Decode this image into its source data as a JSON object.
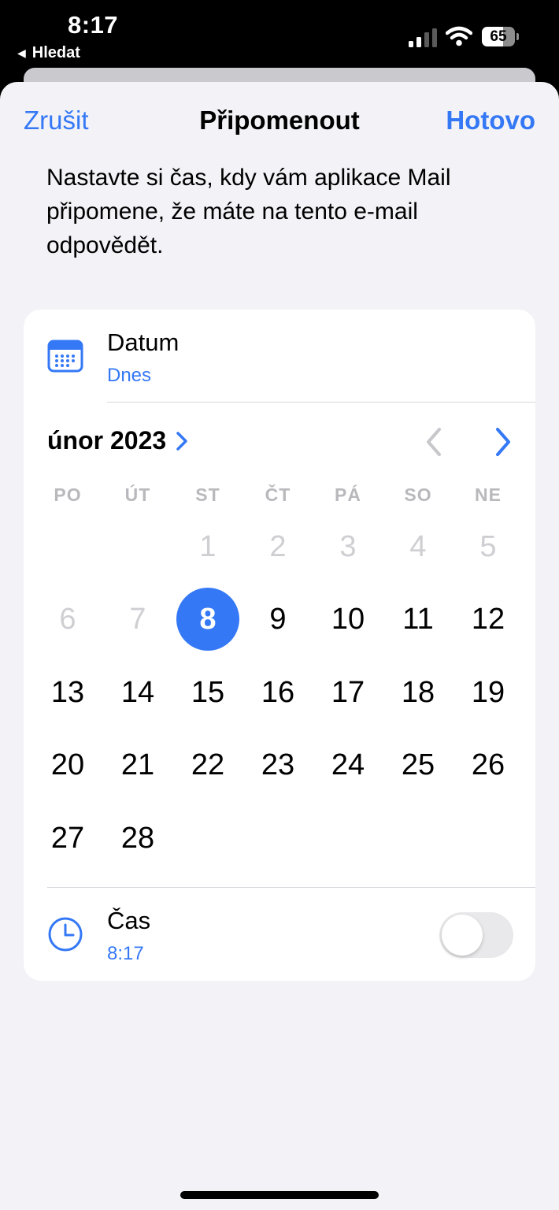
{
  "status_bar": {
    "time": "8:17",
    "back_app": "Hledat",
    "battery_level": "65",
    "battery_fraction": 0.65
  },
  "nav": {
    "cancel_label": "Zrušit",
    "title": "Připomenout",
    "done_label": "Hotovo"
  },
  "description": "Nastavte si čas, kdy vám aplikace Mail připomene, že máte na tento e-mail odpovědět.",
  "date_row": {
    "label": "Datum",
    "value": "Dnes",
    "icon": "calendar-icon"
  },
  "calendar": {
    "month_label": "únor 2023",
    "weekdays": [
      "PO",
      "ÚT",
      "ST",
      "ČT",
      "PÁ",
      "SO",
      "NE"
    ],
    "first_weekday_index": 2,
    "days_in_month": 28,
    "selected_day": 8,
    "today": 8,
    "disabled_before_day": 8
  },
  "time_row": {
    "label": "Čas",
    "value": "8:17",
    "icon": "clock-icon",
    "toggle_on": false
  },
  "colors": {
    "accent": "#3478f6",
    "sheet_background": "#f2f2f7",
    "muted_text": "#cfcfd3",
    "weekday_text": "#b9b9bd"
  }
}
